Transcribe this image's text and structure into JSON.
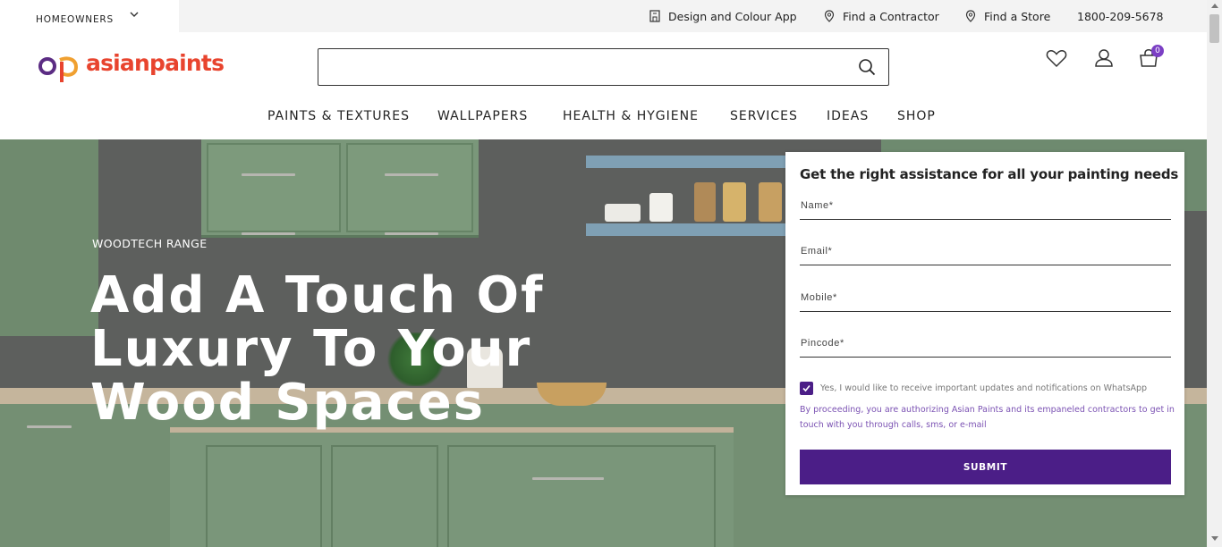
{
  "utility_bar": {
    "segment_label": "HOMEOWNERS",
    "links": [
      {
        "label": "Design and Colour App",
        "icon": "building-icon"
      },
      {
        "label": "Find a Contractor",
        "icon": "location-pin-icon"
      },
      {
        "label": "Find a Store",
        "icon": "location-pin-icon"
      },
      {
        "label": "1800-209-5678",
        "icon": ""
      }
    ]
  },
  "header": {
    "logo_text": "asianpaints",
    "search_placeholder": "",
    "cart_count": "0"
  },
  "nav": {
    "items": [
      "PAINTS & TEXTURES",
      "WALLPAPERS",
      "HEALTH & HYGIENE",
      "SERVICES",
      "IDEAS",
      "SHOP"
    ]
  },
  "hero": {
    "kicker": "WOODTECH RANGE",
    "title_line1": "Add A Touch Of",
    "title_line2": "Luxury To Your",
    "title_line3": "Wood Spaces"
  },
  "form": {
    "title": "Get the right assistance for all your painting needs",
    "name_placeholder": "Name*",
    "email_placeholder": "Email*",
    "mobile_placeholder": "Mobile*",
    "pincode_placeholder": "Pincode*",
    "whatsapp_label": "Yes, I would like to receive important updates and notifications on WhatsApp",
    "whatsapp_checked": true,
    "consent_text": "By proceeding, you are authorizing Asian Paints and its empaneled contractors to get in touch with you through calls, sms, or e-mail",
    "submit_label": "SUBMIT"
  },
  "colors": {
    "brand_purple": "#4b1e87",
    "logo_orange": "#e8442e",
    "badge_purple": "#7b3fc4"
  }
}
